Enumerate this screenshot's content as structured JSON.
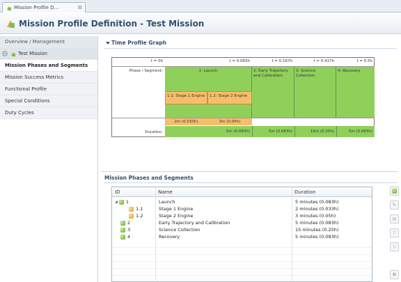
{
  "editor_tab": {
    "label": "Mission Profile D...",
    "close": "☒"
  },
  "header": {
    "title": "Mission Profile Definition - Test Mission"
  },
  "sidebar": {
    "overview": "Overview / Management",
    "project": "Test Mission",
    "items": [
      {
        "label": "Mission Phases and Segments",
        "active": true
      },
      {
        "label": "Mission Success Metrics"
      },
      {
        "label": "Functional Profile"
      },
      {
        "label": "Special Conditions"
      },
      {
        "label": "Duty Cycles"
      }
    ]
  },
  "time_profile": {
    "heading": "Time Profile Graph",
    "time_marks": [
      "t = 0h",
      "t = 0.083h",
      "t = 0.167h",
      "t = 0.417h",
      "t = 0.5h"
    ],
    "phase_label": "Phase / Segment:",
    "duration_label": "Duration:",
    "phases": [
      {
        "label": "1: Launch",
        "duration": "5m (0.083h)"
      },
      {
        "label": "2: Early Trajectory and Calibration",
        "duration": "5m (0.083h)"
      },
      {
        "label": "3: Science Collection",
        "duration": "15m (0.25h)"
      },
      {
        "label": "4: Recovery",
        "duration": "5m (0.083h)"
      }
    ],
    "segments": [
      {
        "label": "1.1: Stage 1 Engine",
        "duration": "2m (0.033h)"
      },
      {
        "label": "1.2: Stage 2 Engine",
        "duration": "3m (0.05h)"
      }
    ]
  },
  "phases_table": {
    "heading": "Mission Phases and Segments",
    "columns": [
      "ID",
      "Name",
      "Duration"
    ],
    "rows": [
      {
        "id": "1",
        "name": "Launch",
        "duration": "5 minutes (0.083h)"
      },
      {
        "id": "1.1",
        "name": "Stage 1 Engine",
        "duration": "2 minutes (0.033h)"
      },
      {
        "id": "1.2",
        "name": "Stage 2 Engine",
        "duration": "3 minutes (0.05h)"
      },
      {
        "id": "2",
        "name": "Early Trajectory and Calibration",
        "duration": "5 minutes (0.083h)"
      },
      {
        "id": "3",
        "name": "Science Collection",
        "duration": "15 minutes (0.25h)"
      },
      {
        "id": "4",
        "name": "Recovery",
        "duration": "5 minutes (0.083h)"
      }
    ]
  },
  "colors": {
    "phase": "#8fd05a",
    "segment": "#f7bd6a",
    "title": "#34506f"
  },
  "icons": [
    "mission-profile-icon",
    "collapse-toggle-icon",
    "expand-triangle-icon",
    "phase-cube-icon",
    "segment-cube-icon",
    "add-icon",
    "edit-icon",
    "copy-icon",
    "move-up-icon",
    "move-down-icon",
    "delete-icon"
  ]
}
